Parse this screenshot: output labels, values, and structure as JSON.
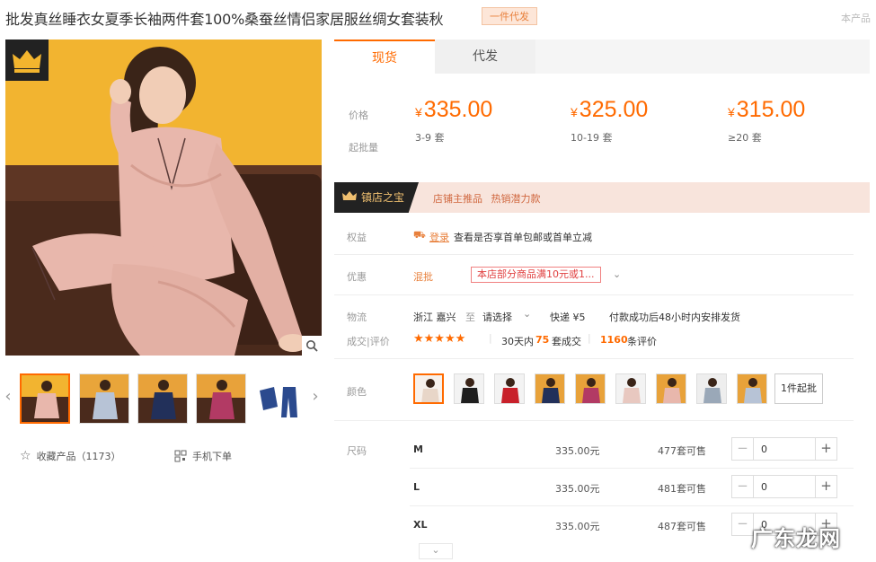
{
  "title": {
    "text": "批发真丝睡衣女夏季长袖两件套100%桑蚕丝情侣家居服丝绸女套装秋",
    "tag": "一件代发",
    "right": "本产品"
  },
  "gallery": {
    "thumb_count": 5,
    "active_thumb": 0,
    "favorite": "收藏产品（1173）",
    "mobile_order": "手机下单"
  },
  "tabs": [
    "现货",
    "代发"
  ],
  "pricing": {
    "price_label": "价格",
    "moq_label": "起批量",
    "tiers": [
      {
        "currency": "¥",
        "price": "335.00",
        "qty": "3-9 套"
      },
      {
        "currency": "¥",
        "price": "325.00",
        "qty": "10-19 套"
      },
      {
        "currency": "¥",
        "price": "315.00",
        "qty": "≥20 套"
      }
    ]
  },
  "treasure": {
    "badge": "镇店之宝",
    "text": "店铺主推品 热销潜力款"
  },
  "rights": {
    "label": "权益",
    "login": "登录",
    "text": "查看是否享首单包邮或首单立减"
  },
  "discount": {
    "label": "优惠",
    "wholesale": "混批",
    "coupon": "本店部分商品满10元或1..."
  },
  "logistics": {
    "label": "物流",
    "origin": "浙江 嘉兴",
    "to": "至",
    "select": "请选择",
    "express": "快递 ¥5",
    "ship": "付款成功后48小时内安排发货"
  },
  "reviews": {
    "label": "成交|评价",
    "stars": "★★★★★",
    "rating": 5,
    "deals_prefix": "30天内",
    "deals_count": "75",
    "deals_suffix": "套成交",
    "review_count": "1160",
    "review_suffix": "条评价"
  },
  "color": {
    "label": "颜色",
    "swatch_count": 9,
    "active": 0,
    "one_wholesale": "1件起批"
  },
  "sizes": {
    "label": "尺码",
    "rows": [
      {
        "name": "M",
        "price": "335.00元",
        "stock": "477套可售",
        "qty": "0"
      },
      {
        "name": "L",
        "price": "335.00元",
        "stock": "481套可售",
        "qty": "0"
      },
      {
        "name": "XL",
        "price": "335.00元",
        "stock": "487套可售",
        "qty": "0"
      }
    ],
    "minus": "−",
    "plus": "+"
  },
  "expand": "⌄",
  "watermark": "广东龙网",
  "colors": {
    "accent": "#ff6a00",
    "badge_dark": "#222222",
    "treasure_bg": "#f8e4dc",
    "photo_bg": "#f3b52e",
    "silk_pink": "#e8b7ac"
  }
}
